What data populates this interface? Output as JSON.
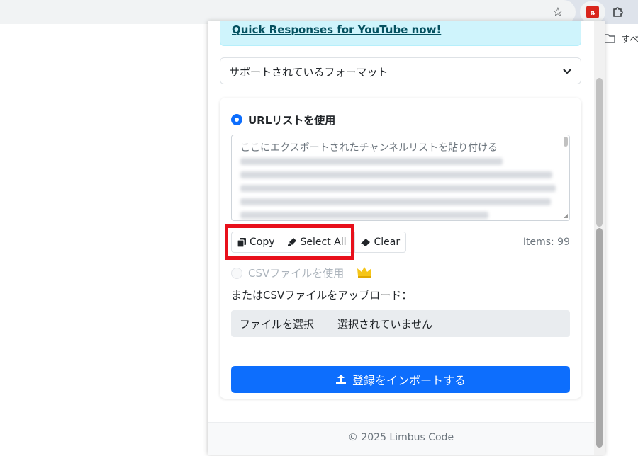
{
  "browser": {
    "bookmarks_label": "すべ"
  },
  "popup": {
    "promo_text": "Quick Responses for YouTube now!",
    "format_select": "サポートされているフォーマット",
    "url_option_label": "URLリストを使用",
    "textarea_placeholder": "ここにエクスポートされたチャンネルリストを貼り付ける",
    "buttons": {
      "copy": "Copy",
      "select_all": "Select All",
      "clear": "Clear"
    },
    "items_count": "Items: 99",
    "csv_option_label": "CSVファイルを使用",
    "upload_label": "またはCSVファイルをアップロード：",
    "file_button": "ファイルを選択",
    "file_status": "選択されていません",
    "import_button": "登録をインポートする",
    "footer": "© 2025 Limbus Code"
  },
  "colors": {
    "primary": "#0d6efd",
    "highlight": "#e8101b",
    "promo_bg": "#cff4fc",
    "premium": "#f5c518"
  },
  "icons": [
    "star-icon",
    "extension-logo-icon",
    "puzzle-icon",
    "folder-icon",
    "chevron-down-icon",
    "copy-icon",
    "marker-icon",
    "eraser-icon",
    "crown-icon",
    "upload-icon"
  ]
}
